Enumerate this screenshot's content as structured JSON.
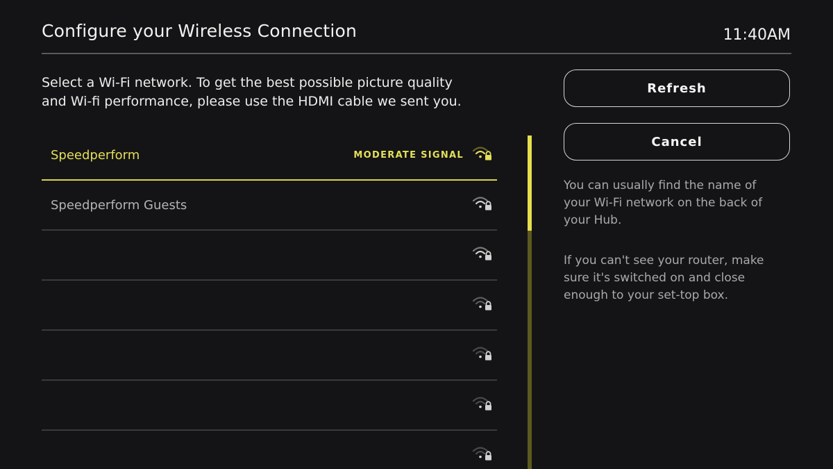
{
  "header": {
    "title": "Configure your Wireless Connection",
    "time": "11:40AM"
  },
  "intro": {
    "line1": "Select a Wi-Fi network. To get the best possible picture quality",
    "line2": "and Wi-fi performance, please use the HDMI cable we sent you."
  },
  "networks": [
    {
      "name": "Speedperform",
      "signal_label": "MODERATE SIGNAL",
      "selected": true,
      "signal_icon": "wifi-moderate-locked-icon"
    },
    {
      "name": "Speedperform Guests",
      "signal_label": "",
      "selected": false,
      "signal_icon": "wifi-locked-icon"
    },
    {
      "name": "",
      "signal_label": "",
      "selected": false,
      "signal_icon": "wifi-locked-icon"
    },
    {
      "name": "",
      "signal_label": "",
      "selected": false,
      "signal_icon": "wifi-locked-icon"
    },
    {
      "name": "",
      "signal_label": "",
      "selected": false,
      "signal_icon": "wifi-locked-icon"
    },
    {
      "name": "",
      "signal_label": "",
      "selected": false,
      "signal_icon": "wifi-locked-icon"
    },
    {
      "name": "",
      "signal_label": "",
      "selected": false,
      "signal_icon": "wifi-locked-icon"
    }
  ],
  "actions": {
    "refresh_label": "Refresh",
    "cancel_label": "Cancel"
  },
  "help": {
    "p1_line1": "You can usually find the name of",
    "p1_line2": "your Wi-Fi network on the back of",
    "p1_line3": "your Hub.",
    "p2_line1": "If you can't see your router, make",
    "p2_line2": "sure it's switched on and close",
    "p2_line3": "enough to your set-top box."
  },
  "colors": {
    "accent": "#e5df5a",
    "background": "#141416",
    "divider": "#3a3a3d",
    "scroll_track": "#5b5a1e"
  }
}
